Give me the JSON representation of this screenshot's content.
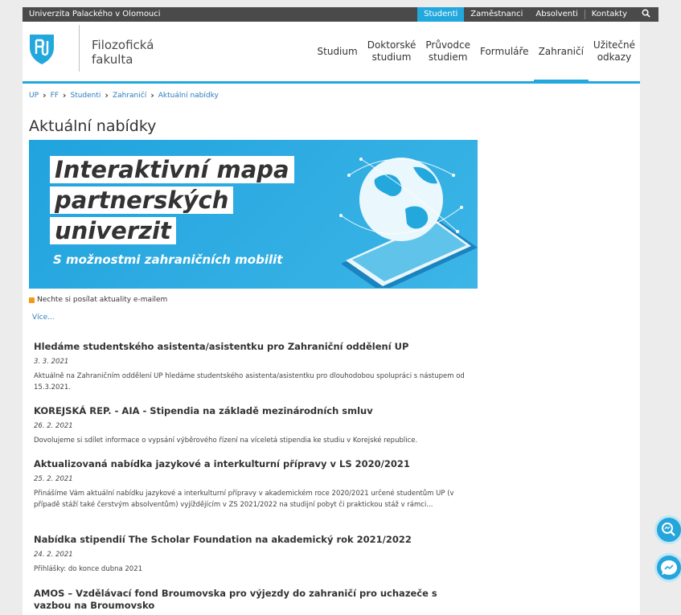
{
  "topbar": {
    "university": "Univerzita Palackého v Olomouci",
    "links": [
      "Studenti",
      "Zaměstnanci",
      "Absolventi",
      "Kontakty"
    ],
    "active": "Studenti"
  },
  "header": {
    "faculty_line1": "Filozofická",
    "faculty_line2": "fakulta",
    "nav": [
      {
        "l1": "Studium",
        "l2": ""
      },
      {
        "l1": "Doktorské",
        "l2": "studium"
      },
      {
        "l1": "Průvodce",
        "l2": "studiem"
      },
      {
        "l1": "Formuláře",
        "l2": ""
      },
      {
        "l1": "Zahraničí",
        "l2": ""
      },
      {
        "l1": "Užitečné",
        "l2": "odkazy"
      }
    ]
  },
  "breadcrumb": [
    "UP",
    "FF",
    "Studenti",
    "Zahraničí",
    "Aktuální nabídky"
  ],
  "page_title": "Aktuální nabídky",
  "banner": {
    "line1": "Interaktivní mapa",
    "line2": "partnerských",
    "line3": "univerzit",
    "subtitle": "S možnostmi zahraničních mobilit"
  },
  "rss_text": "Nechte si posílat aktuality e-mailem",
  "more_link": "Více...",
  "news": [
    {
      "title": "Hledáme studentského asistenta/asistentku pro Zahraniční oddělení UP",
      "date": "3. 3. 2021",
      "text": "Aktuálně na Zahraničním oddělení UP hledáme studentského asistenta/asistentku pro dlouhodobou spolupráci s nástupem od 15.3.2021."
    },
    {
      "title": "KOREJSKÁ REP. - AIA - Stipendia na základě mezinárodních smluv",
      "date": "26. 2. 2021",
      "text": "Dovolujeme si sdílet informace o vypsání výběrového řízení na víceletá stipendia ke studiu v Korejské republice."
    },
    {
      "title": "Aktualizovaná nabídka jazykové a interkulturní přípravy v LS 2020/2021",
      "date": "25. 2. 2021",
      "text": "Přinášíme Vám aktuální nabídku jazykové a interkulturní přípravy v akademickém roce 2020/2021 určené studentům UP (v případě stáží také čerstvým absolventům) vyjíždějícím v ZS 2021/2022 na studijní pobyt či praktickou stáž v rámci..."
    },
    {
      "title": "Nabídka stipendií The Scholar Foundation na akademický rok 2021/2022",
      "date": "24. 2. 2021",
      "text": "Přihlášky: do konce dubna 2021"
    },
    {
      "title": "AMOS – Vzdělávací fond Broumovska pro výjezdy do zahraničí pro uchazeče s vazbou na Broumovsko",
      "date": "",
      "text": ""
    }
  ]
}
